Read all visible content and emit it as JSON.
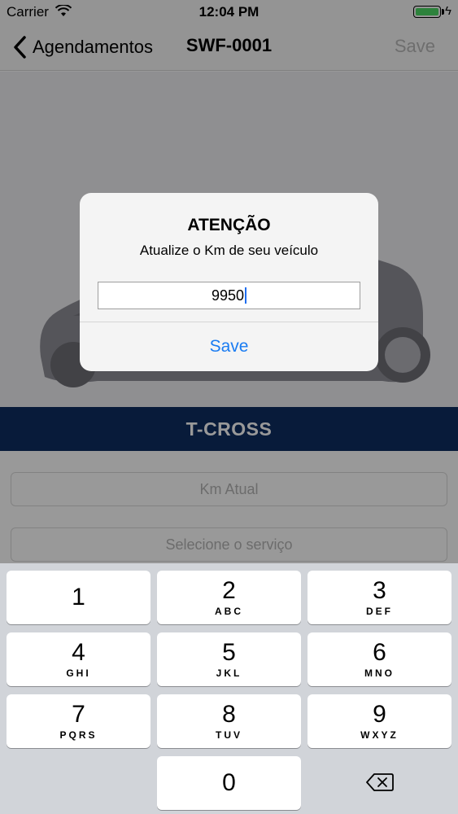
{
  "status_bar": {
    "carrier": "Carrier",
    "time": "12:04 PM"
  },
  "nav": {
    "back_label": "Agendamentos",
    "title": "SWF-0001",
    "save_label": "Save"
  },
  "vehicle": {
    "model": "T-CROSS"
  },
  "form": {
    "km_placeholder": "Km Atual",
    "service_placeholder": "Selecione o serviço"
  },
  "alert": {
    "title": "ATENÇÃO",
    "message": "Atualize o Km de seu veículo",
    "input_value": "9950",
    "save_label": "Save"
  },
  "keyboard": {
    "keys": [
      {
        "num": "1",
        "letters": ""
      },
      {
        "num": "2",
        "letters": "ABC"
      },
      {
        "num": "3",
        "letters": "DEF"
      },
      {
        "num": "4",
        "letters": "GHI"
      },
      {
        "num": "5",
        "letters": "JKL"
      },
      {
        "num": "6",
        "letters": "MNO"
      },
      {
        "num": "7",
        "letters": "PQRS"
      },
      {
        "num": "8",
        "letters": "TUV"
      },
      {
        "num": "9",
        "letters": "WXYZ"
      },
      {
        "num": "0",
        "letters": ""
      }
    ]
  },
  "colors": {
    "model_bar": "#0e2d62",
    "alert_action": "#1a7cf2",
    "battery": "#4cd964",
    "keyboard_bg": "#d1d4d9"
  }
}
